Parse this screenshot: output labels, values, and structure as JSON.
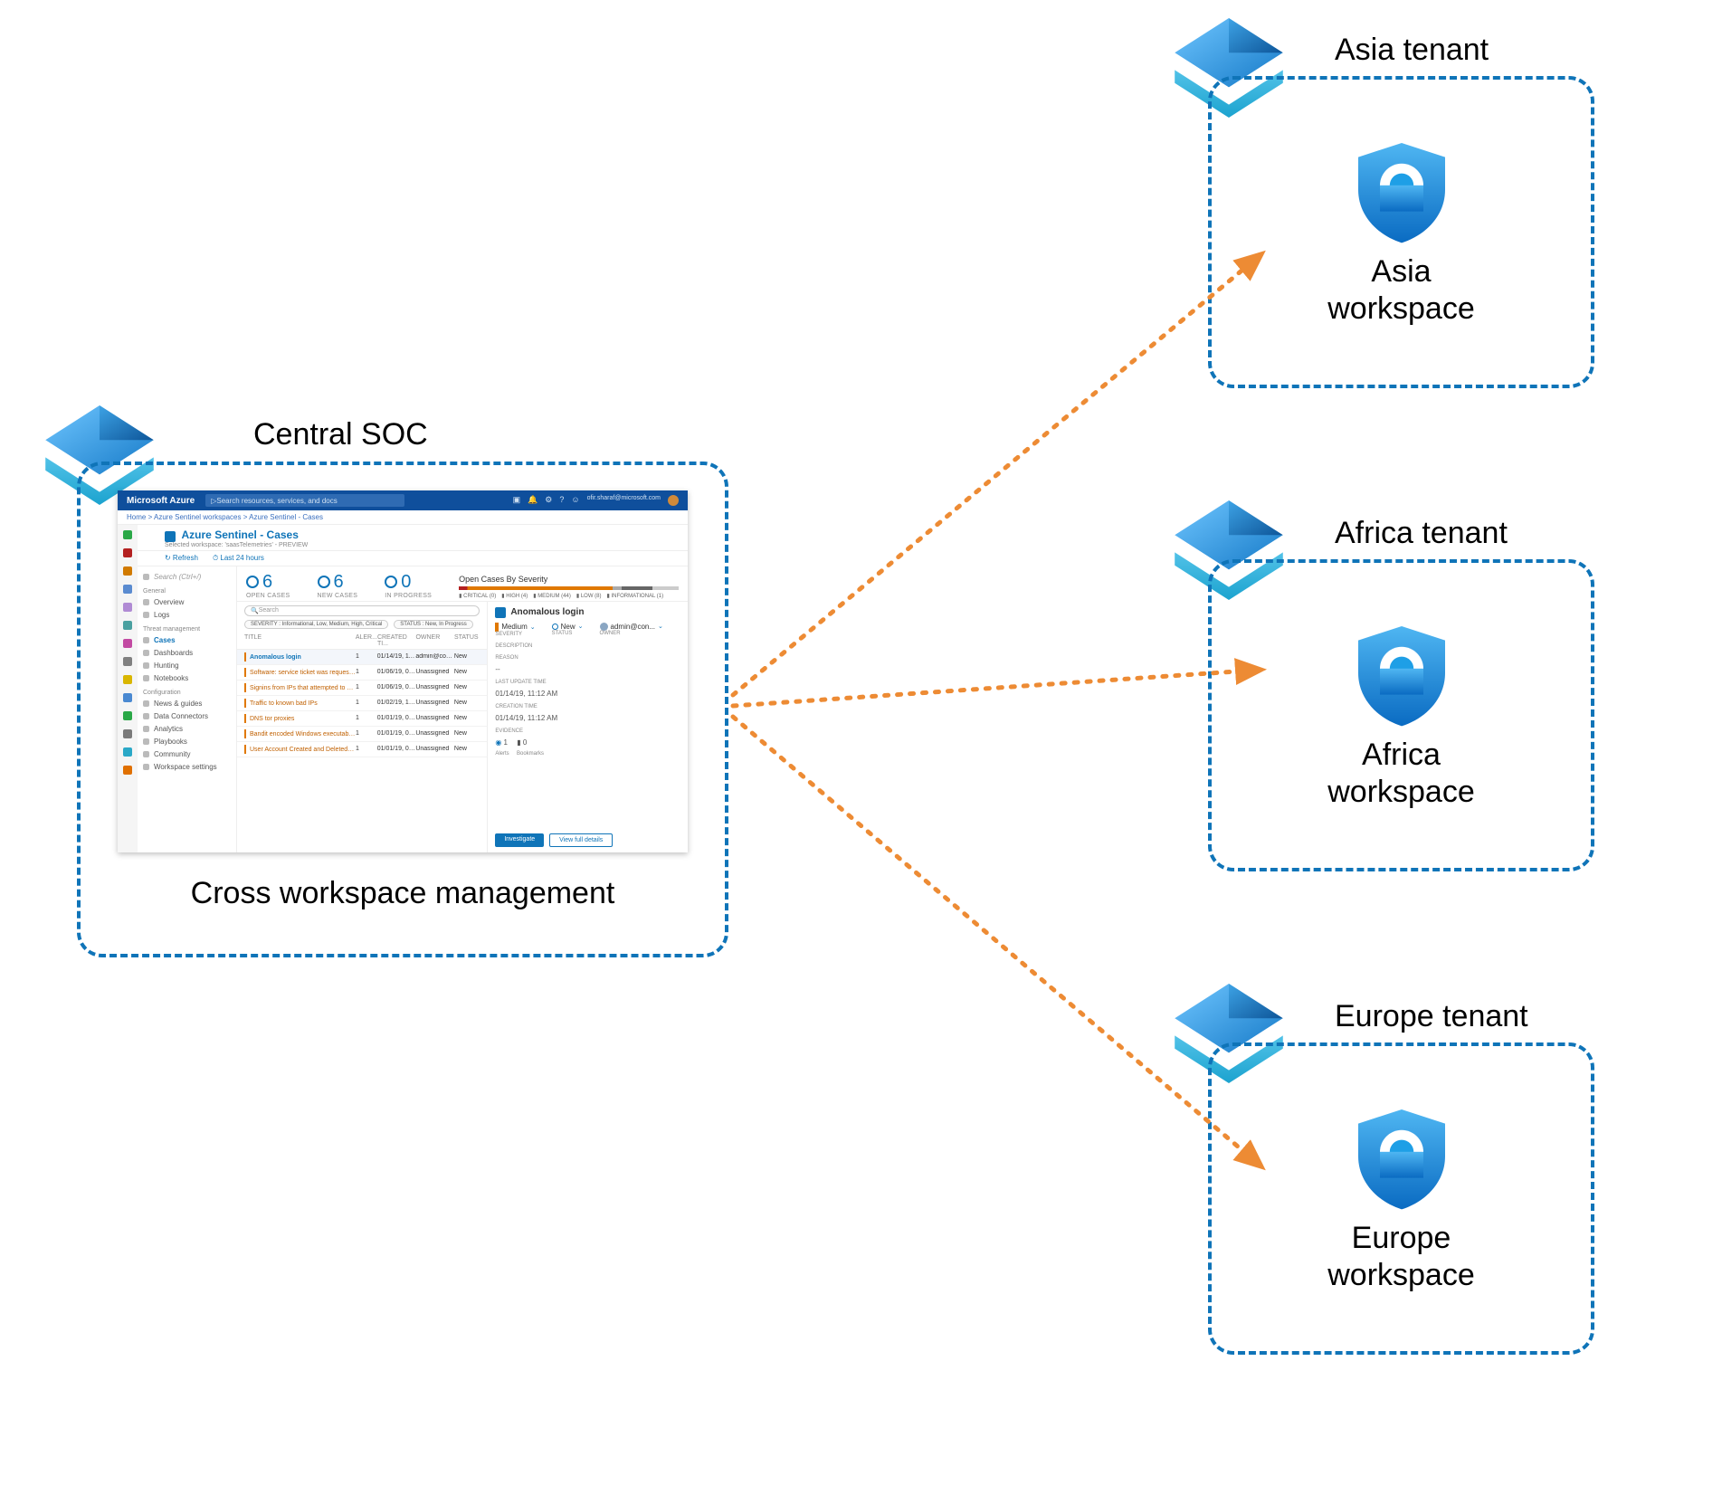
{
  "central": {
    "title": "Central SOC",
    "caption": "Cross workspace management"
  },
  "tenants": [
    {
      "title": "Asia tenant",
      "workspace1": "Asia",
      "workspace2": "workspace"
    },
    {
      "title": "Africa tenant",
      "workspace1": "Africa",
      "workspace2": "workspace"
    },
    {
      "title": "Europe tenant",
      "workspace1": "Europe",
      "workspace2": "workspace"
    }
  ],
  "dashboard": {
    "brand": "Microsoft Azure",
    "search_placeholder": "Search resources, services, and docs",
    "user": "ofir.sharaf@microsoft.com",
    "breadcrumb": "Home > Azure Sentinel workspaces > Azure Sentinel - Cases",
    "page_title": "Azure Sentinel - Cases",
    "page_subtitle": "Selected workspace: 'saasTelemetries' - PREVIEW",
    "actions": {
      "refresh": "↻ Refresh",
      "last24": "⏱ Last 24 hours"
    },
    "sidebar_search": "Search (Ctrl+/)",
    "sidebar": {
      "general_label": "General",
      "general": [
        "Overview",
        "Logs"
      ],
      "threat_label": "Threat management",
      "threat": [
        "Cases",
        "Dashboards",
        "Hunting",
        "Notebooks"
      ],
      "config_label": "Configuration",
      "config": [
        "News & guides",
        "Data Connectors",
        "Analytics",
        "Playbooks",
        "Community",
        "Workspace settings"
      ]
    },
    "stats": {
      "open_cases": {
        "value": "6",
        "label": "OPEN CASES"
      },
      "new_cases": {
        "value": "6",
        "label": "NEW CASES"
      },
      "in_progress": {
        "value": "0",
        "label": "IN PROGRESS"
      }
    },
    "severity": {
      "title": "Open Cases By Severity",
      "legend": [
        "CRITICAL (0)",
        "HIGH (4)",
        "MEDIUM (44)",
        "LOW (8)",
        "INFORMATIONAL (1)"
      ]
    },
    "table": {
      "search": "Search",
      "filter_severity": "SEVERITY : Informational, Low, Medium, High, Critical",
      "filter_status": "STATUS : New, In Progress",
      "columns": [
        "TITLE",
        "ALER...",
        "CREATED TI...",
        "OWNER",
        "STATUS"
      ],
      "rows": [
        {
          "title": "Anomalous login",
          "alerts": "1",
          "created": "01/14/19, 11:...",
          "owner": "admin@contoso.c...",
          "status": "New",
          "selected": true
        },
        {
          "title": "Software: service ticket was requested",
          "alerts": "1",
          "created": "01/06/19, 09:...",
          "owner": "Unassigned",
          "status": "New"
        },
        {
          "title": "Signins from IPs that attempted to sign...",
          "alerts": "1",
          "created": "01/06/19, 09:...",
          "owner": "Unassigned",
          "status": "New"
        },
        {
          "title": "Traffic to known bad IPs",
          "alerts": "1",
          "created": "01/02/19, 10:...",
          "owner": "Unassigned",
          "status": "New"
        },
        {
          "title": "DNS tor proxies",
          "alerts": "1",
          "created": "01/01/19, 07:...",
          "owner": "Unassigned",
          "status": "New"
        },
        {
          "title": "Bandit encoded Windows executable f...",
          "alerts": "1",
          "created": "01/01/19, 07:...",
          "owner": "Unassigned",
          "status": "New"
        },
        {
          "title": "User Account Created and Deleted withi...",
          "alerts": "1",
          "created": "01/01/19, 08:...",
          "owner": "Unassigned",
          "status": "New"
        }
      ]
    },
    "detail": {
      "title": "Anomalous login",
      "severity_k": "Medium",
      "severity_lbl": "SEVERITY",
      "status_k": "New",
      "status_lbl": "STATUS",
      "owner_k": "admin@con...",
      "owner_lbl": "OWNER",
      "desc_lbl": "DESCRIPTION",
      "reason_lbl": "REASON",
      "reason_v": "--",
      "last_update_lbl": "LAST UPDATE TIME",
      "last_update_v": "01/14/19, 11:12 AM",
      "creation_lbl": "CREATION TIME",
      "creation_v": "01/14/19, 11:12 AM",
      "evidence_lbl": "EVIDENCE",
      "alerts": "1",
      "alerts_lbl": "Alerts",
      "bookmarks": "0",
      "bookmarks_lbl": "Bookmarks",
      "investigate": "Investigate",
      "view_full": "View full details"
    }
  },
  "rail_colors": [
    "#2aa847",
    "#b32020",
    "#d17a00",
    "#5a8bd0",
    "#b08bd4",
    "#4aa0a0",
    "#c24aa2",
    "#808080",
    "#d9b600",
    "#4a89d1",
    "#2aa847",
    "#7a7a7a",
    "#2aa8c7",
    "#e07000"
  ]
}
